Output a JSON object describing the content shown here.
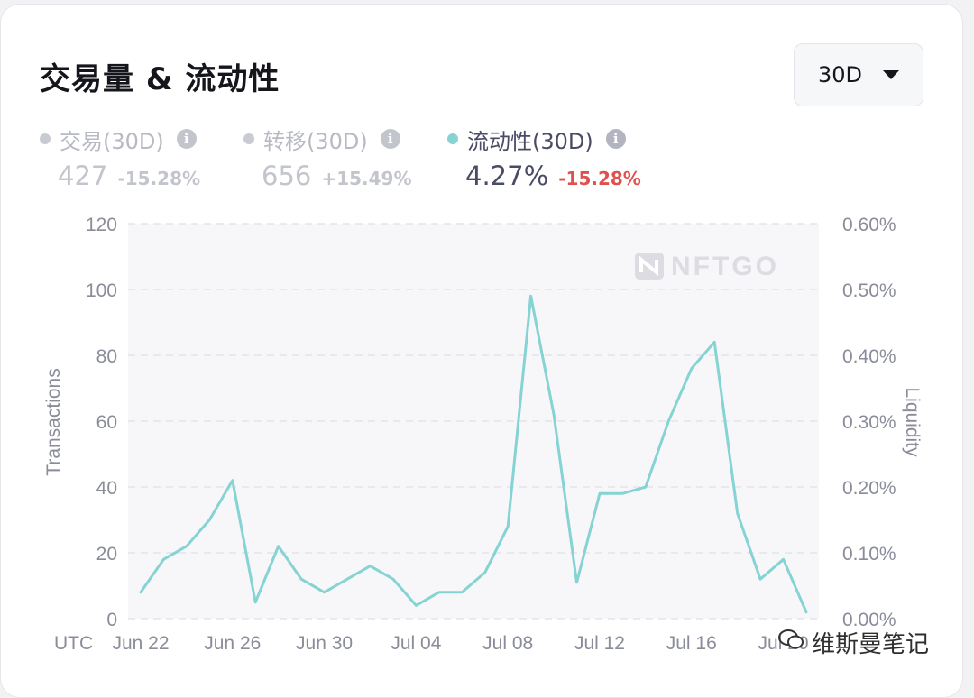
{
  "title": "交易量 & 流动性",
  "range_selector": {
    "value": "30D"
  },
  "stats": [
    {
      "label": "交易(30D)",
      "value": "427",
      "change": "-15.28%",
      "dot_color": "#c9cbd2",
      "active": false
    },
    {
      "label": "转移(30D)",
      "value": "656",
      "change": "+15.49%",
      "dot_color": "#c9cbd2",
      "active": false
    },
    {
      "label": "流动性(30D)",
      "value": "4.27%",
      "change": "-15.28%",
      "dot_color": "#86d3d3",
      "active": true
    }
  ],
  "chart_brand": "NFTGO",
  "watermark_text": "维斯曼笔记",
  "chart_data": {
    "type": "line",
    "ylabel": "Transactions",
    "y2label": "Liquidity",
    "ylim": [
      0,
      120
    ],
    "y_ticks": [
      "0",
      "20",
      "40",
      "60",
      "80",
      "100",
      "120"
    ],
    "y2lim": [
      0,
      0.6
    ],
    "y2_ticks": [
      "0.00%",
      "0.10%",
      "0.20%",
      "0.30%",
      "0.40%",
      "0.50%",
      "0.60%"
    ],
    "x_timezone_label": "UTC",
    "x_tick_labels": [
      "Jun 22",
      "Jun 26",
      "Jun 30",
      "Jul 04",
      "Jul 08",
      "Jul 12",
      "Jul 16",
      "Jul 20"
    ],
    "grid": true,
    "series": [
      {
        "axis": "right",
        "color": "#86d3d3",
        "x": [
          "Jun 22",
          "Jun 23",
          "Jun 24",
          "Jun 25",
          "Jun 26",
          "Jun 27",
          "Jun 28",
          "Jun 29",
          "Jun 30",
          "Jul 01",
          "Jul 02",
          "Jul 03",
          "Jul 04",
          "Jul 05",
          "Jul 06",
          "Jul 07",
          "Jul 08",
          "Jul 09",
          "Jul 10",
          "Jul 11",
          "Jul 12",
          "Jul 13",
          "Jul 14",
          "Jul 15",
          "Jul 16",
          "Jul 17",
          "Jul 18",
          "Jul 19",
          "Jul 20",
          "Jul 21"
        ],
        "values": [
          0.04,
          0.09,
          0.11,
          0.15,
          0.21,
          0.025,
          0.11,
          0.06,
          0.04,
          0.06,
          0.08,
          0.06,
          0.02,
          0.04,
          0.04,
          0.07,
          0.14,
          0.49,
          0.31,
          0.055,
          0.19,
          0.19,
          0.2,
          0.3,
          0.38,
          0.42,
          0.16,
          0.06,
          0.09,
          0.01
        ]
      }
    ]
  }
}
